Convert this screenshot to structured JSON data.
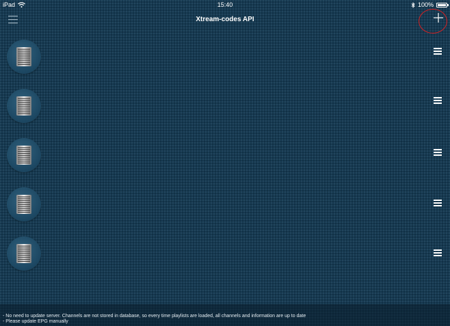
{
  "status_bar": {
    "device": "iPad",
    "time": "15:40",
    "battery": "100%",
    "battery_level": 1.0
  },
  "nav": {
    "title": "Xtream-codes API",
    "menu_icon": "hamburger-menu-icon",
    "add_icon": "plus-icon"
  },
  "servers": [
    {
      "icon": "server-rack-icon",
      "menu_icon": "row-menu-icon"
    },
    {
      "icon": "server-rack-icon",
      "menu_icon": "row-menu-icon"
    },
    {
      "icon": "server-rack-icon",
      "menu_icon": "row-menu-icon"
    },
    {
      "icon": "server-rack-icon",
      "menu_icon": "row-menu-icon"
    },
    {
      "icon": "server-rack-icon",
      "menu_icon": "row-menu-icon"
    }
  ],
  "footer": {
    "line1": "- No need to update server. Channels are not stored in database, so every time playlists are loaded, all channels and information are up to date",
    "line2": "- Please update EPG manually"
  },
  "colors": {
    "background": "#163a52",
    "highlight_ring": "#d92020",
    "text": "#ffffff"
  }
}
